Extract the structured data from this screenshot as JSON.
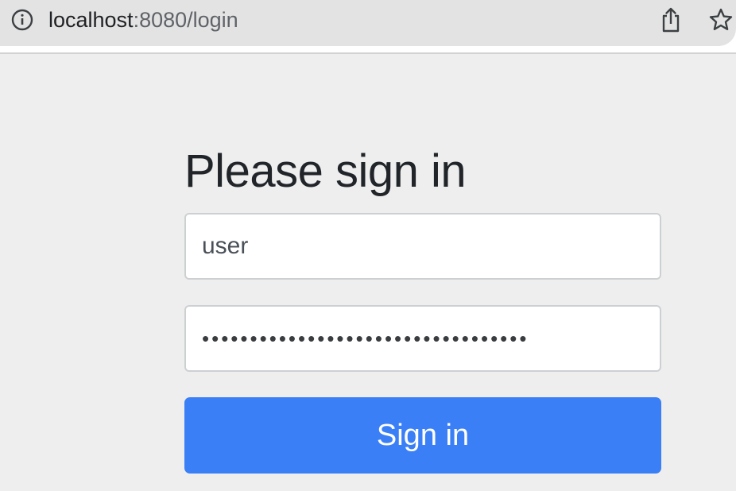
{
  "browser": {
    "url_host": "localhost",
    "url_rest": ":8080/login"
  },
  "login": {
    "heading": "Please sign in",
    "username_value": "user",
    "password_value": "••••••••••••••••••••••••••••••••••",
    "submit_label": "Sign in"
  },
  "colors": {
    "page_background": "#eeeeee",
    "button": "#3a7ff6",
    "heading": "#212529"
  }
}
